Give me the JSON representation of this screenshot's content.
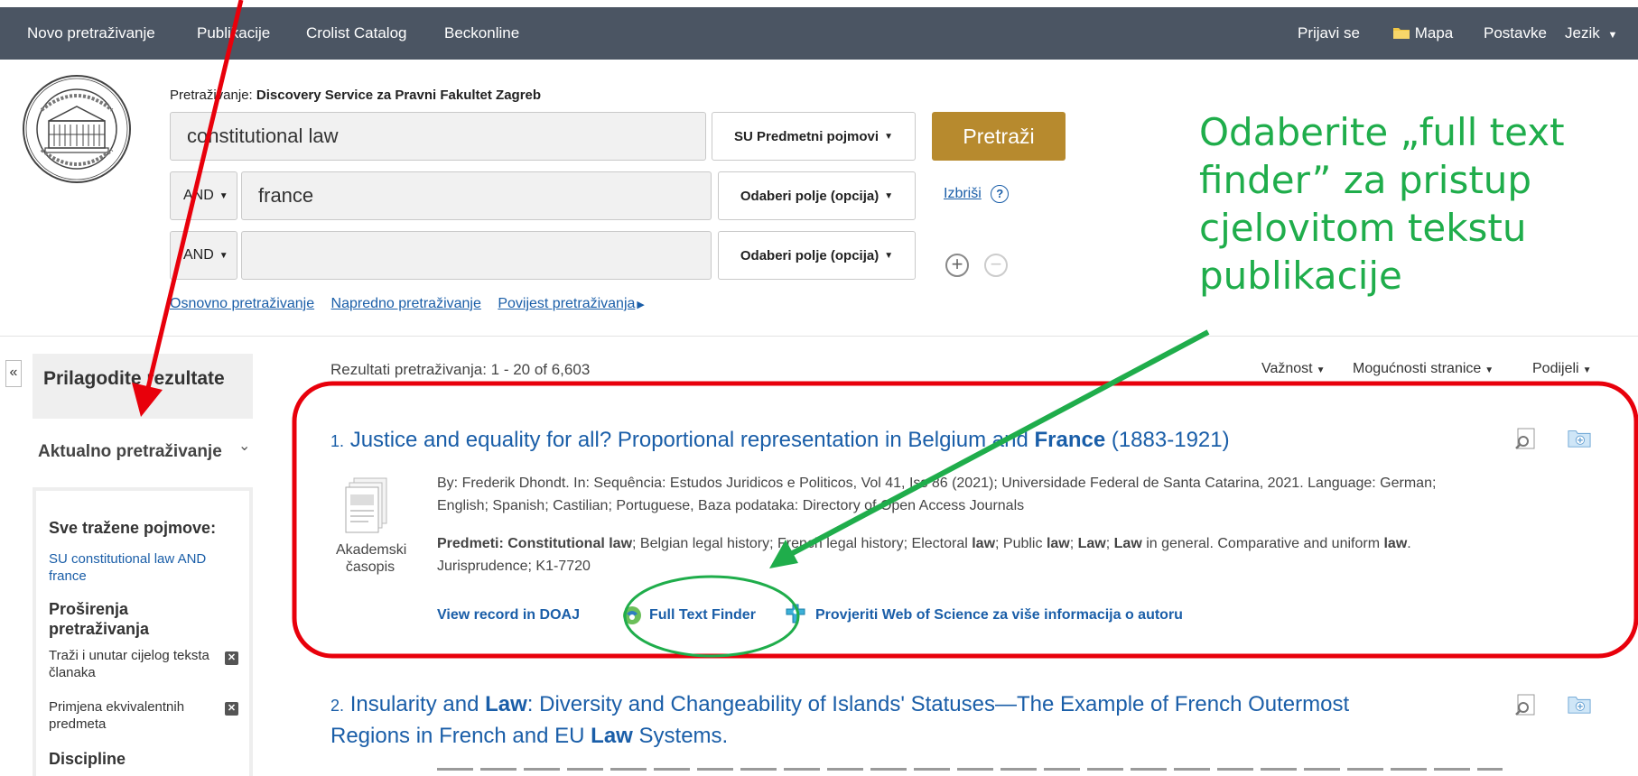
{
  "topnav": {
    "new_search": "Novo pretraživanje",
    "publications": "Publikacije",
    "crolist": "Crolist Catalog",
    "beck": "Beckonline",
    "sign_in": "Prijavi se",
    "folder": "Mapa",
    "settings": "Postavke",
    "language": "Jezik"
  },
  "search": {
    "searching_prefix": "Pretraživanje:",
    "searching_db": "Discovery Service za Pravni Fakultet Zagreb",
    "row1_value": "constitutional law",
    "row1_field": "SU Predmetni pojmovi",
    "row2_op": "AND",
    "row2_value": "france",
    "row2_field": "Odaberi polje (opcija)",
    "row3_op": "AND",
    "row3_value": "",
    "row3_field": "Odaberi polje (opcija)",
    "button": "Pretraži",
    "clear": "Izbriši",
    "help": "?"
  },
  "links": {
    "basic": "Osnovno pretraživanje",
    "advanced": "Napredno pretraživanje",
    "history": "Povijest pretraživanja"
  },
  "annotation": {
    "text": "Odaberite „full text finder” za pristup cjelovitom tekstu publikacije"
  },
  "sidebar": {
    "collapse": "«",
    "title": "Prilagodite rezultate",
    "current_search": "Aktualno pretraživanje",
    "all_terms_label": "Sve tražene pojmove:",
    "all_terms_value": "SU constitutional law AND france",
    "expanders_label": "Proširenja pretraživanja",
    "expander1": "Traži i unutar cijelog teksta članaka",
    "expander2": "Primjena ekvivalentnih predmeta",
    "disciplines_label": "Discipline"
  },
  "results": {
    "count": "Rezultati pretraživanja: 1 - 20 of 6,603",
    "sort": "Važnost",
    "page_options": "Mogućnosti stranice",
    "share": "Podijeli",
    "r1": {
      "num": "1.",
      "title_a": "Justice and equality for all? Proportional representation in Belgium and ",
      "title_b": "France",
      "title_c": " (1883-1921)",
      "meta1": "By: Frederik Dhondt. In: Sequência: Estudos Juridicos e Politicos, Vol 41, Iss 86 (2021); Universidade Federal de Santa Catarina, 2021. Language: German;",
      "meta2": "English; Spanish; Castilian; Portuguese, Baza podataka: Directory of Open Access Journals",
      "subjects_label": "Predmeti: Constitutional ",
      "subjects_law": "law",
      "subjects_rest1": "; Belgian legal history; French legal history; Electoral ",
      "subjects_law2": "law",
      "subjects_rest2": "; Public ",
      "subjects_law3": "law",
      "subjects_rest3": "; ",
      "subjects_law4": "Law",
      "subjects_rest4": "; ",
      "subjects_law5": "Law",
      "subjects_rest5": " in general. Comparative and uniform ",
      "subjects_law6": "law",
      "subjects_rest6": ".",
      "subjects_line2": "Jurisprudence; K1-7720",
      "pubtype": "Akademski časopis",
      "view_doaj": "View record in DOAJ",
      "full_text_finder": "Full Text Finder",
      "wos": "Provjeriti Web of Science za više informacija o autoru"
    },
    "r2": {
      "num": "2.",
      "t1": "Insularity and ",
      "t2": "Law",
      "t3": ": Diversity and Changeability of Islands' Statuses—The Example of French Outermost",
      "t4": "Regions in French and EU ",
      "t5": "Law",
      "t6": " Systems."
    }
  },
  "colors": {
    "topbar": "#4b5563",
    "search_button": "#b78a2e",
    "link": "#1a5ea8",
    "annotation_green": "#1fad4b",
    "annotation_red": "#e8000b"
  }
}
